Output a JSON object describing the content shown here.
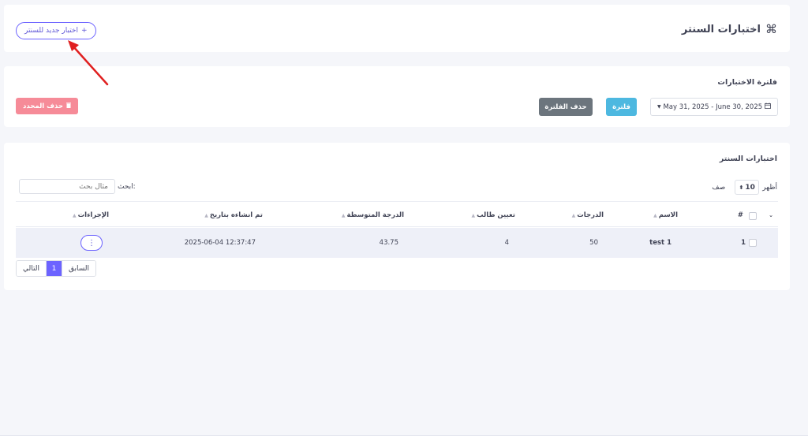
{
  "header": {
    "title": "اختبارات السنتر",
    "title_icon": "⌘",
    "new_button_label": "اختبار جديد للسنتر",
    "new_button_icon": "+"
  },
  "filter": {
    "title": "فلترة الاختبارات",
    "date_range": "May 31, 2025 - June 30, 2025",
    "filter_button": "فلترة",
    "clear_button": "حذف الفلترة",
    "delete_selected_button": "حذف المحدد"
  },
  "table_card": {
    "title": "اختبارات السنتر",
    "show_prefix": "أظهر",
    "page_size": "10",
    "show_suffix": "صف",
    "search_label": "ابحث:",
    "search_placeholder": "مثال بحث",
    "columns": {
      "index": "#",
      "name": "الاسم",
      "grades": "الدرجات",
      "assign": "تعيين طالب",
      "avg": "الدرجة المتوسطة",
      "created": "تم انشاءه بتاريخ",
      "actions": "الإجراءات"
    },
    "rows": [
      {
        "index": "1",
        "name": "test 1",
        "grades": "50",
        "assign": "4",
        "avg": "43.75",
        "created": "2025-06-04 12:37:47",
        "actions": "⋮"
      }
    ],
    "pagination": {
      "prev": "السابق",
      "current": "1",
      "next": "التالي"
    }
  },
  "colors": {
    "accent": "#6c63ff",
    "info": "#4db8e0",
    "secondary": "#6c757d",
    "danger": "#f68b98",
    "annotation_arrow": "#e02020"
  }
}
